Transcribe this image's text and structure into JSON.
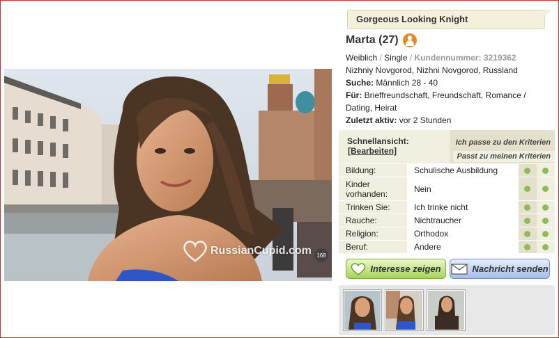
{
  "profile": {
    "headline": "Gorgeous Looking Knight",
    "name_age": "Marta (27)",
    "gender": "Weiblich",
    "status": "Single",
    "customer_label": "Kundennummer:",
    "customer_number": "3219362",
    "location": "Nizhniy Novgorod, Nizhni Novgorod, Russland",
    "search_label": "Suche:",
    "search_value": "Männlich 28 - 40",
    "for_label": "Für:",
    "for_value": "Brieffreundschaft, Freundschaft, Romance / Dating, Heirat",
    "last_active_label": "Zuletzt aktiv:",
    "last_active_value": "vor 2 Stunden"
  },
  "quick_view": {
    "title": "Schnellansicht:",
    "edit_link": "[Bearbeiten]",
    "col1_header": "Ich passe zu den Kriterien",
    "col2_header": "Passt zu meinen Kriterien",
    "rows": [
      {
        "label": "Bildung:",
        "value": "Schulische Ausbildung"
      },
      {
        "label": "Kinder vorhanden:",
        "value": "Nein"
      },
      {
        "label": "Trinken Sie:",
        "value": "Ich trinke nicht"
      },
      {
        "label": "Rauche:",
        "value": "Nichtraucher"
      },
      {
        "label": "Religion:",
        "value": "Orthodox"
      },
      {
        "label": "Beruf:",
        "value": "Andere"
      }
    ]
  },
  "actions": {
    "interest": "Interesse zeigen",
    "message": "Nachricht senden"
  },
  "photo": {
    "watermark": "RussianCupid.com",
    "count": "168"
  },
  "colors": {
    "match_dot": "#8fba59",
    "avatar": "#e08a2c"
  }
}
